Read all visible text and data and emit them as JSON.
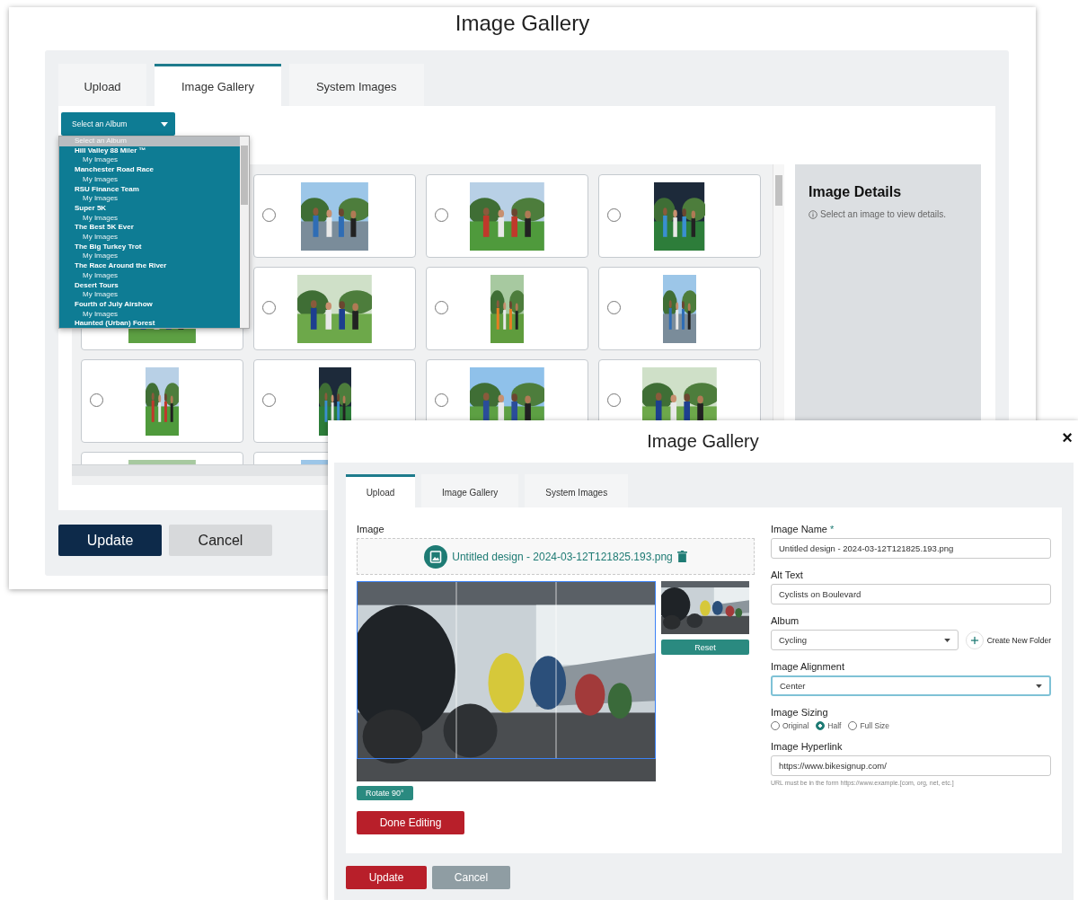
{
  "gallery_window": {
    "title": "Image Gallery",
    "tabs": [
      {
        "label": "Upload",
        "selected": false
      },
      {
        "label": "Image Gallery",
        "selected": true
      },
      {
        "label": "System Images",
        "selected": false
      }
    ],
    "album_select": {
      "value": "Select an Album",
      "expanded": true,
      "options": [
        {
          "label": "Select an Album",
          "kind": "placeholder",
          "selected": true
        },
        {
          "label": "Hill Valley 88 Miler ™",
          "kind": "album",
          "selected": false
        },
        {
          "label": "My Images",
          "kind": "folder",
          "selected": false
        },
        {
          "label": "Manchester Road Race",
          "kind": "album",
          "selected": false
        },
        {
          "label": "My Images",
          "kind": "folder",
          "selected": false
        },
        {
          "label": "RSU Finance Team",
          "kind": "album",
          "selected": false
        },
        {
          "label": "My Images",
          "kind": "folder",
          "selected": false
        },
        {
          "label": "Super 5K",
          "kind": "album",
          "selected": false
        },
        {
          "label": "My Images",
          "kind": "folder",
          "selected": false
        },
        {
          "label": "The Best 5K Ever",
          "kind": "album",
          "selected": false
        },
        {
          "label": "My Images",
          "kind": "folder",
          "selected": false
        },
        {
          "label": "The Big Turkey Trot",
          "kind": "album",
          "selected": false
        },
        {
          "label": "My Images",
          "kind": "folder",
          "selected": false
        },
        {
          "label": "The Race Around the River",
          "kind": "album",
          "selected": false
        },
        {
          "label": "My Images",
          "kind": "folder",
          "selected": false
        },
        {
          "label": "Desert Tours",
          "kind": "album",
          "selected": false
        },
        {
          "label": "My Images",
          "kind": "folder",
          "selected": false
        },
        {
          "label": "Fourth of July Airshow",
          "kind": "album",
          "selected": false
        },
        {
          "label": "My Images",
          "kind": "folder",
          "selected": false
        },
        {
          "label": "Haunted (Urban) Forest",
          "kind": "album",
          "selected": false
        }
      ]
    },
    "details": {
      "title": "Image Details",
      "hint": "Select an image to view details."
    },
    "buttons": [
      {
        "label": "Update",
        "kind": "primary"
      },
      {
        "label": "Cancel",
        "kind": "secondary"
      }
    ]
  },
  "upload_window": {
    "title": "Image Gallery",
    "close": "×",
    "tabs": [
      {
        "label": "Upload",
        "selected": true
      },
      {
        "label": "Image Gallery",
        "selected": false
      },
      {
        "label": "System Images",
        "selected": false
      }
    ],
    "image_label": "Image",
    "file_name": "Untitled design - 2024-03-12T121825.193.png",
    "reset": "Reset",
    "rotate": "Rotate 90°",
    "done": "Done Editing",
    "fields": [
      {
        "kind": "text",
        "label": "Image Name",
        "required_mark": "*",
        "value": "Untitled design - 2024-03-12T121825.193.png",
        "focused": false
      },
      {
        "kind": "text",
        "label": "Alt Text",
        "value": "Cyclists on Boulevard",
        "focused": false
      },
      {
        "kind": "select",
        "label": "Album",
        "value": "Cycling",
        "focused": false,
        "action": "Create New Folder"
      },
      {
        "kind": "select",
        "label": "Image Alignment",
        "value": "Center",
        "focused": true
      },
      {
        "kind": "radios",
        "label": "Image Sizing",
        "options": [
          {
            "label": "Original",
            "selected": false
          },
          {
            "label": "Half",
            "selected": true
          },
          {
            "label": "Full Size",
            "selected": false
          }
        ]
      },
      {
        "kind": "text",
        "label": "Image Hyperlink",
        "value": "https://www.bikesignup.com/",
        "focused": false,
        "hint": "URL must be in the form https://www.example.[com, org, net, etc.]"
      }
    ],
    "buttons": [
      {
        "label": "Update",
        "kind": "primary"
      },
      {
        "label": "Cancel",
        "kind": "secondary"
      }
    ]
  }
}
